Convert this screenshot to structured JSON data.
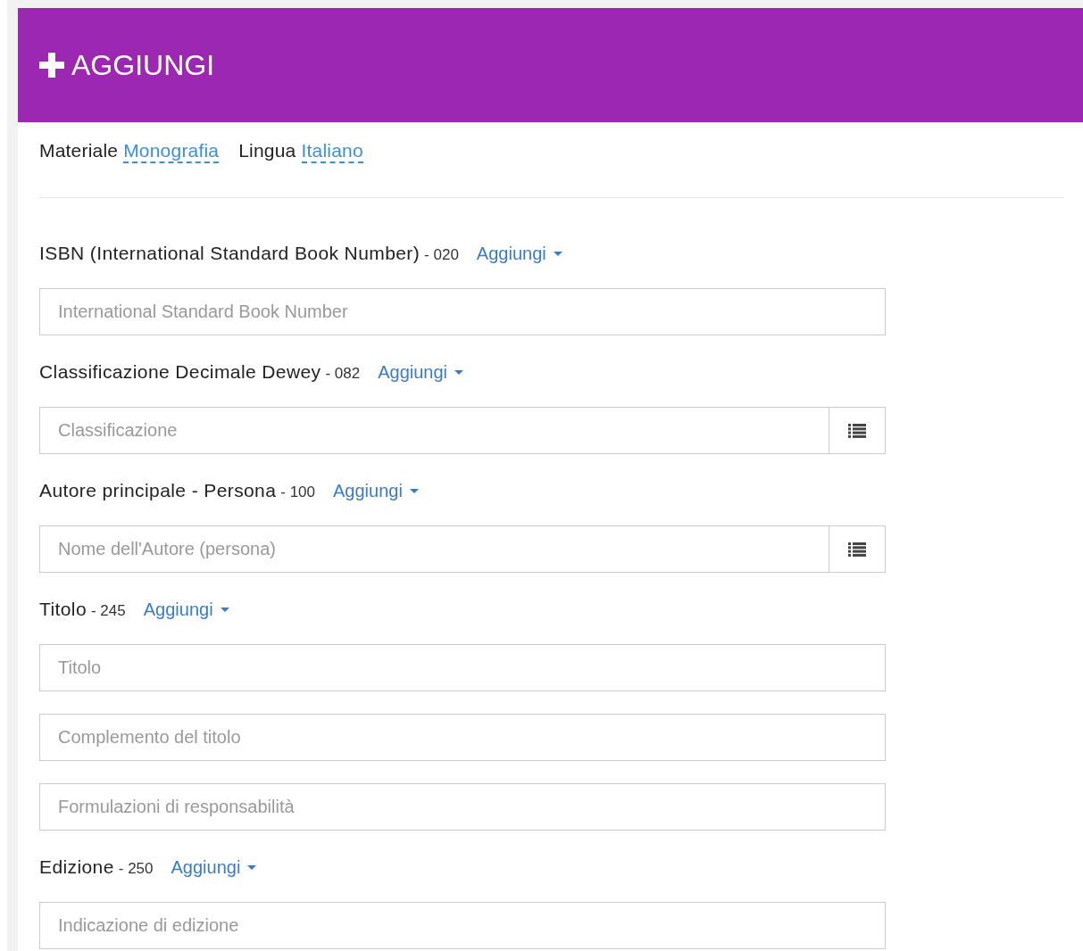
{
  "header": {
    "title": "AGGIUNGI"
  },
  "meta": [
    {
      "label": "Materiale",
      "value": "Monografia"
    },
    {
      "label": "Lingua",
      "value": "Italiano"
    }
  ],
  "sections": [
    {
      "label": "ISBN (International Standard Book Number)",
      "code": "- 020",
      "add": "Aggiungi",
      "fields": [
        {
          "placeholder": "International Standard Book Number",
          "list_button": false
        }
      ]
    },
    {
      "label": "Classificazione Decimale Dewey",
      "code": "- 082",
      "add": "Aggiungi",
      "fields": [
        {
          "placeholder": "Classificazione",
          "list_button": true
        }
      ]
    },
    {
      "label": "Autore principale - Persona",
      "code": "- 100",
      "add": "Aggiungi",
      "fields": [
        {
          "placeholder": "Nome dell'Autore (persona)",
          "list_button": true
        }
      ]
    },
    {
      "label": "Titolo",
      "code": "- 245",
      "add": "Aggiungi",
      "fields": [
        {
          "placeholder": "Titolo",
          "list_button": false
        },
        {
          "placeholder": "Complemento del titolo",
          "list_button": false
        },
        {
          "placeholder": "Formulazioni di responsabilità",
          "list_button": false
        }
      ]
    },
    {
      "label": "Edizione",
      "code": "- 250",
      "add": "Aggiungi",
      "fields": [
        {
          "placeholder": "Indicazione di edizione",
          "list_button": false
        }
      ]
    }
  ]
}
